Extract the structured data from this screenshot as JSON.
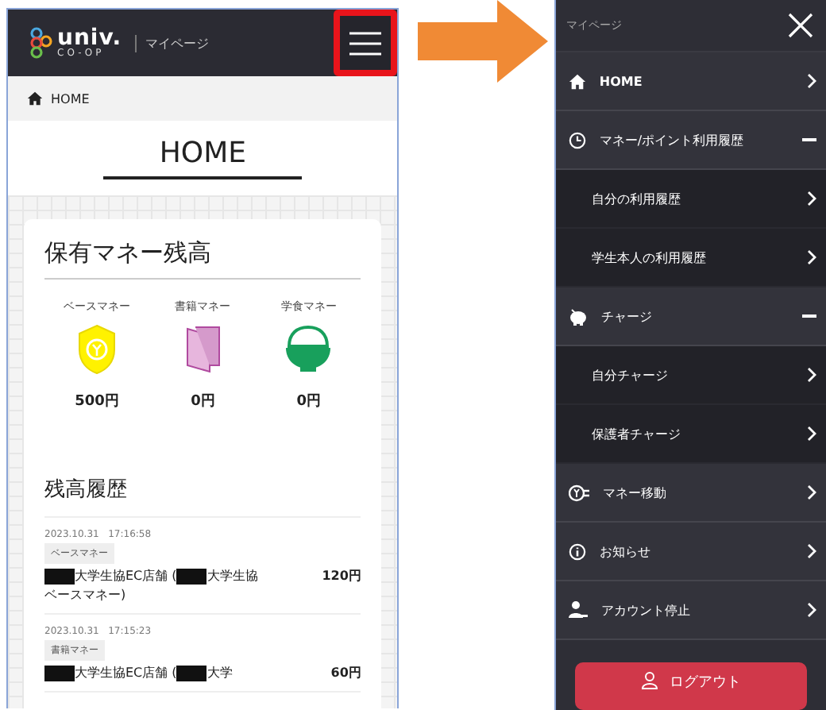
{
  "left_screen": {
    "header": {
      "logo_text": "univ.",
      "logo_subtext": "CO-OP",
      "page_label": "マイページ",
      "menu_highlighted": true
    },
    "breadcrumb": "HOME",
    "page_title": "HOME",
    "balance_card": {
      "title": "保有マネー残高",
      "balances": [
        {
          "label": "ベースマネー",
          "amount": "500円"
        },
        {
          "label": "書籍マネー",
          "amount": "0円"
        },
        {
          "label": "学食マネー",
          "amount": "0円"
        }
      ]
    },
    "history": {
      "title": "残高履歴",
      "entries": [
        {
          "date": "2023.10.31",
          "time": "17:16:58",
          "tag": "ベースマネー",
          "description": [
            {
              "kind": "redacted"
            },
            {
              "kind": "text",
              "text": "大学生協EC店舗 ("
            },
            {
              "kind": "redacted"
            },
            {
              "kind": "text",
              "text": "大学生協ベースマネー)"
            }
          ],
          "amount": "120円"
        },
        {
          "date": "2023.10.31",
          "time": "17:15:23",
          "tag": "書籍マネー",
          "description": [
            {
              "kind": "redacted"
            },
            {
              "kind": "text",
              "text": "大学生協EC店舗 ("
            },
            {
              "kind": "redacted"
            },
            {
              "kind": "text",
              "text": "大学"
            }
          ],
          "amount": "60円"
        }
      ]
    }
  },
  "right_screen": {
    "header": {
      "page_label": "マイページ"
    },
    "menu": [
      {
        "label": "HOME",
        "kind": "link"
      },
      {
        "label": "マネー/ポイント利用履歴",
        "kind": "group",
        "expanded": true,
        "children": [
          {
            "label": "自分の利用履歴"
          },
          {
            "label": "学生本人の利用履歴"
          }
        ]
      },
      {
        "label": "チャージ",
        "kind": "group",
        "expanded": true,
        "children": [
          {
            "label": "自分チャージ"
          },
          {
            "label": "保護者チャージ"
          }
        ]
      },
      {
        "label": "マネー移動",
        "kind": "link"
      },
      {
        "label": "お知らせ",
        "kind": "link"
      },
      {
        "label": "アカウント停止",
        "kind": "link"
      }
    ],
    "logout_button": "ログアウト"
  }
}
